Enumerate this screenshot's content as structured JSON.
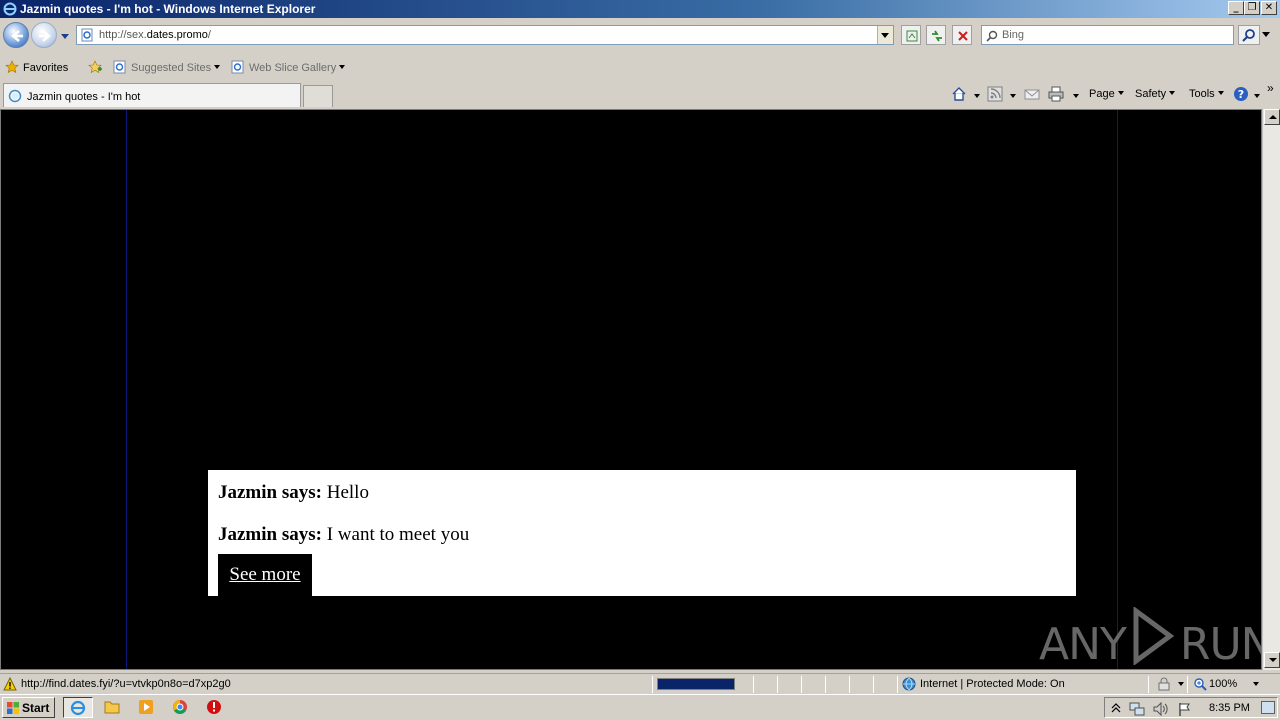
{
  "window": {
    "title": "Jazmin quotes - I'm hot - Windows Internet Explorer",
    "minimize_glyph": "_",
    "restore_glyph": "❐",
    "close_glyph": "✕"
  },
  "address": {
    "url_prefix": "http://sex.",
    "url_domain": "dates.promo",
    "url_suffix": "/"
  },
  "search": {
    "placeholder": "Bing"
  },
  "favorites_bar": {
    "favorites_label": "Favorites",
    "items": [
      {
        "label": "Suggested Sites",
        "icon": "ie-page-icon"
      },
      {
        "label": "Web Slice Gallery",
        "icon": "ie-page-icon"
      }
    ]
  },
  "tab": {
    "label": "Jazmin quotes - I'm hot"
  },
  "command_bar": {
    "page": "Page",
    "safety": "Safety",
    "tools": "Tools",
    "more": "»"
  },
  "page": {
    "messages": [
      {
        "speaker": "Jazmin says:",
        "text": "Hello"
      },
      {
        "speaker": "Jazmin says:",
        "text": "I want to meet you"
      }
    ],
    "see_more": "See more"
  },
  "watermark": {
    "left": "ANY",
    "right": "RUN"
  },
  "status": {
    "link": "http://find.dates.fyi/?u=vtvkp0n8o=d7xp2g0",
    "progress_fraction": 1.0,
    "zone": "Internet | Protected Mode: On",
    "zoom": "100%"
  },
  "taskbar": {
    "start": "Start",
    "clock": "8:35 PM"
  },
  "colors": {
    "title_bar": "#0a246a",
    "page_background": "#000000",
    "chat_background": "#ffffff",
    "progress": "#0a246a"
  }
}
